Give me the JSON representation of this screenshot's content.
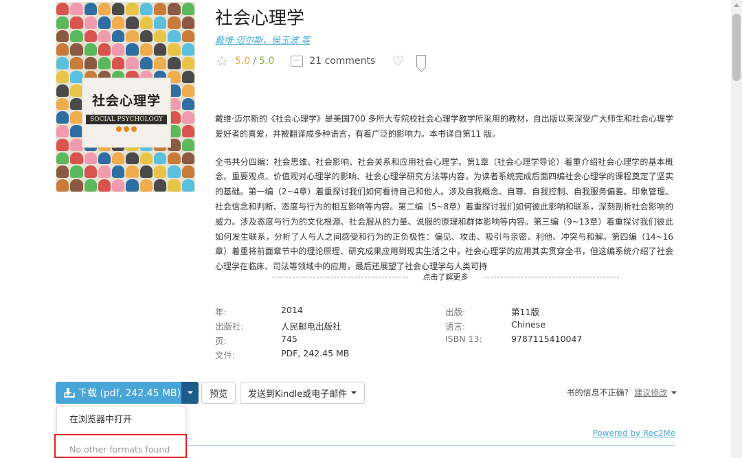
{
  "book": {
    "title": "社会心理学",
    "authors": "戴维·迈尔斯，侯玉波 等",
    "rating": "5.0",
    "rating_sep": "/",
    "rating_max": "5.0",
    "comments": "21 comments"
  },
  "cover": {
    "title_cn": "社会心理学",
    "title_en": "SOCIAL PSYCHOLOGY",
    "colors": [
      "#d9534f",
      "#f0ad4e",
      "#5bc0de",
      "#5cb85c",
      "#2f6ea3",
      "#e8c547",
      "#8a5a44",
      "#f29ab0",
      "#4a4a4a",
      "#c97b3a"
    ]
  },
  "description": {
    "para1": "戴维·迈尔斯的《社会心理学》是美国700 多所大专院校社会心理学教学所采用的教材，自出版以来深受广大师生和社会心理学爱好者的喜爱，并被翻译成多种语言，有着广泛的影响力。本书译自第11 版。",
    "para2": "全书共分四编：社会思维、社会影响、社会关系和应用社会心理学。第1章（社会心理学导论）着重介绍社会心理学的基本概念、重要观点、价值观对心理学的影响、社会心理学研究方法等内容，为读者系统完成后面四编社会心理学的课程奠定了坚实的基础。第一编（2~4章）着重探讨我们如何看待自己和他人。涉及自我概念、自尊、自我控制、自我服务偏差、印象管理、社会信念和判断、态度与行为的相互影响等内容。第二编（5~8章）着重探讨我们如何彼此影响和联系，深刻剖析社会影响的威力。涉及态度与行为的文化根源、社会服从的力量、说服的原理和群体影响等内容。第三编（9~13章）着重探讨我们彼此如何发生联系，分析了人与人之间感受和行为的正负极性：偏见、攻击、吸引与亲密、利他、冲突与和解。第四编（14~16 章）着重将前面章节中的理论原理、研究成果应用到现实生活之中，社会心理学的应用其实贯穿全书，但这编系统介绍了社会心理学在临床、司法等领域中的应用，最后还展望了社会心理学与人类可持",
    "more_label": "点击了解更多"
  },
  "details": [
    {
      "label": "年:",
      "value": "2014"
    },
    {
      "label": "出版:",
      "value": "第11版"
    },
    {
      "label": "出版社:",
      "value": "人民邮电出版社"
    },
    {
      "label": "语言:",
      "value": "Chinese"
    },
    {
      "label": "页:",
      "value": "745"
    },
    {
      "label": "ISBN 13:",
      "value": "9787115410047"
    },
    {
      "label": "文件:",
      "value": "PDF, 242.45 MB"
    }
  ],
  "actions": {
    "download_label": "下载 (pdf, 242.45 MB)",
    "preview_label": "预览",
    "send_label": "发送到Kindle或电子邮件",
    "wrong_info_label": "书的信息不正确?",
    "suggest_label": "建议修改"
  },
  "dropdown": {
    "open_in_browser": "在浏览器中打开",
    "no_formats": "No other formats found"
  },
  "footer": {
    "powered_by": "Powered by Rec2Me"
  }
}
